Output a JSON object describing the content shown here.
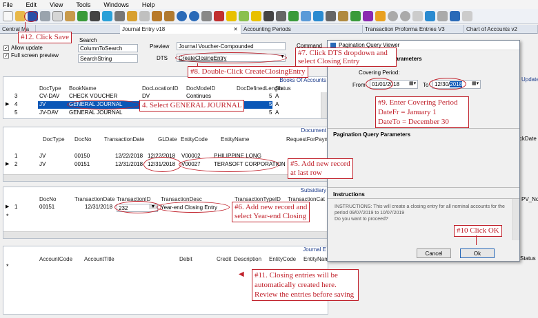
{
  "menu": [
    "File",
    "Edit",
    "View",
    "Tools",
    "Windows",
    "Help"
  ],
  "tabs": [
    "Central Ma",
    "Journal Entry v18",
    "Accounting Periods",
    "Transaction Proforma Entries V3",
    "Chart of Accounts v2"
  ],
  "toolbar_icons": [
    "new-icon",
    "open-icon",
    "save-icon",
    "print-icon",
    "copy-icon",
    "paste-icon",
    "calc-icon",
    "grid-icon",
    "help-icon",
    "info-icon",
    "settings-icon",
    "star-icon",
    "filter-icon",
    "search-icon",
    "zoom-icon",
    "key-icon",
    "chart-icon"
  ],
  "filters": {
    "allow_update": "Allow update",
    "full_screen": "Full screen preview",
    "search_label": "Search",
    "search_col": "ColumnToSearch",
    "search_str": "SearchString",
    "preview_label": "Preview",
    "preview_value": "Journal Voucher-Compounded",
    "dts_label": "DTS",
    "dts_value": "CreateClosingEntry",
    "command_label": "Command"
  },
  "books": {
    "title": "Books Of Accounts",
    "cols": [
      "DocType",
      "BookName",
      "DocLocationID",
      "DocModeID",
      "DocDefinedLength",
      "Status"
    ],
    "rows": [
      {
        "no": "3",
        "doctype": "CV-DAV",
        "book": "CHECK VOUCHER",
        "loc": "DV",
        "mode": "Continues",
        "len": "5",
        "status": "A"
      },
      {
        "no": "4",
        "doctype": "JV",
        "book": "GENERAL JOURNAL",
        "loc": "JV",
        "mode": "",
        "len": "5",
        "status": "A"
      },
      {
        "no": "5",
        "doctype": "JV-DAV",
        "book": "GENERAL JOURNAL",
        "loc": "",
        "mode": "",
        "len": "5",
        "status": "A"
      }
    ]
  },
  "documents": {
    "title": "Document",
    "cols": [
      "DocType",
      "DocNo",
      "TransactionDate",
      "GLDate",
      "EntityCode",
      "EntityName",
      "RequestForPaym"
    ],
    "rows": [
      {
        "no": "1",
        "doctype": "JV",
        "docno": "00150",
        "tdate": "12/22/2018",
        "gldate": "12/22/2018",
        "code": "V00002",
        "name": "PHILIPPINE LONG"
      },
      {
        "no": "2",
        "doctype": "JV",
        "docno": "00151",
        "tdate": "12/31/2018",
        "gldate": "12/31/2018",
        "code": "V00027",
        "name": "TERASOFT CORPORATION"
      }
    ]
  },
  "subsidiary": {
    "title": "Subsidiary",
    "cols": [
      "DocNo",
      "TransactionDate",
      "TransactionID",
      "TransactionDesc",
      "TransactionTypeID",
      "TransactionCat"
    ],
    "row": {
      "no": "1",
      "docno": "00151",
      "tdate": "12/31/2018",
      "tid": "232",
      "desc": "Year-end Closing Entry"
    }
  },
  "journal": {
    "title": "Journal E",
    "cols": [
      "AccountCode",
      "AccountTitle",
      "Debit",
      "Credit",
      "Description",
      "EntityCode",
      "EntityNam",
      "Status"
    ]
  },
  "dialog": {
    "title": "Pagination Query Viewer",
    "params_header": "Parameters",
    "covering": "Covering Period:",
    "from_label": "From",
    "from_value": "01/01/2018",
    "to_label": "To",
    "to_value_a": "12/30/",
    "to_value_b": "2018",
    "pq_header": "Pagination Query Parameters",
    "instr_header": "Instructions",
    "instructions": "INSTRUCTIONS: This will create a closing entry for all nominal accounts for the period 09/07/2019 to 10/07/2019\nDo you want to proceed?",
    "cancel": "Cancel",
    "ok": "Ok"
  },
  "right_edge": {
    "updates": "Updates",
    "heckdate": "heckDate",
    "pv": "PV_No",
    "status": "Status"
  },
  "notes": {
    "n12": "#12. Click Save",
    "n7": "#7. Click DTS dropdown and select Closing Entry",
    "n8": "#8. Double-Click CreateClosingEntry",
    "n4": "4. Select GENERAL JOURNAL",
    "n9a": "#9.  Enter Covering Period",
    "n9b": "DateFr = January 1",
    "n9c": "DateTo = December 30",
    "n5a": "#5. Add new record",
    "n5b": "at last row",
    "n6a": "#6. Add new record and",
    "n6b": "select Year-end Closing",
    "n10": "#10 Click OK",
    "n11a": "#11. Closing entries will be",
    "n11b": "automatically created here.",
    "n11c": "Review the entries before saving"
  },
  "colors": {
    "accent": "#0a57b7",
    "note": "#c0202a"
  }
}
